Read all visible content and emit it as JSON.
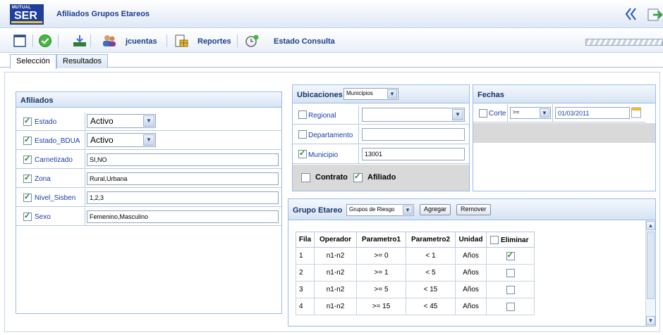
{
  "app": {
    "logo_top": "MUTUAL",
    "logo_main": "SER",
    "title": "Afiliados Grupos Etareos"
  },
  "toolbar": {
    "cuentas_label": "jcuentas",
    "reportes_label": "Reportes",
    "estado_consulta_label": "Estado Consulta"
  },
  "tabs": [
    {
      "label": "Selección",
      "active": true
    },
    {
      "label": "Resultados",
      "active": false
    }
  ],
  "afiliados": {
    "title": "Afiliados",
    "rows": [
      {
        "label": "Estado",
        "checked": true,
        "type": "select",
        "value": "Activo"
      },
      {
        "label": "Estado_BDUA",
        "checked": true,
        "type": "select",
        "value": "Activo"
      },
      {
        "label": "Carnetizado",
        "checked": true,
        "type": "text",
        "value": "SI,NO"
      },
      {
        "label": "Zona",
        "checked": true,
        "type": "text",
        "value": "Rural,Urbana"
      },
      {
        "label": "Nivel_Sisben",
        "checked": true,
        "type": "text",
        "value": "1,2,3"
      },
      {
        "label": "Sexo",
        "checked": true,
        "type": "text",
        "value": "Femenino,Masculino"
      }
    ]
  },
  "ubicaciones": {
    "title": "Ubicaciones",
    "type_select": "Municipios",
    "rows": [
      {
        "label": "Regional",
        "checked": false,
        "type": "select",
        "value": ""
      },
      {
        "label": "Departamento",
        "checked": false,
        "type": "text",
        "value": ""
      },
      {
        "label": "Municipio",
        "checked": true,
        "type": "text",
        "value": "13001"
      }
    ],
    "contrato_label": "Contrato",
    "contrato_checked": false,
    "afiliado_label": "Afiliado",
    "afiliado_checked": true
  },
  "fechas": {
    "title": "Fechas",
    "corte_label": "Corte",
    "corte_checked": false,
    "operator": ">=",
    "date": "01/03/2011"
  },
  "grupo_etareo": {
    "title": "Grupo Etareo",
    "select_value": "Grupos de Riesgo",
    "agregar_label": "Agregar",
    "remover_label": "Remover",
    "columns": [
      "Fila",
      "Operador",
      "Parametro1",
      "Parametro2",
      "Unidad",
      "Eliminar"
    ],
    "rows": [
      {
        "fila": "1",
        "operador": "n1-n2",
        "p1": ">= 0",
        "p2": "< 1",
        "unidad": "Años",
        "eliminar": true
      },
      {
        "fila": "2",
        "operador": "n1-n2",
        "p1": ">= 1",
        "p2": "< 5",
        "unidad": "Años",
        "eliminar": false
      },
      {
        "fila": "3",
        "operador": "n1-n2",
        "p1": ">= 5",
        "p2": "< 15",
        "unidad": "Años",
        "eliminar": false
      },
      {
        "fila": "4",
        "operador": "n1-n2",
        "p1": ">= 15",
        "p2": "< 45",
        "unidad": "Años",
        "eliminar": false
      }
    ]
  }
}
